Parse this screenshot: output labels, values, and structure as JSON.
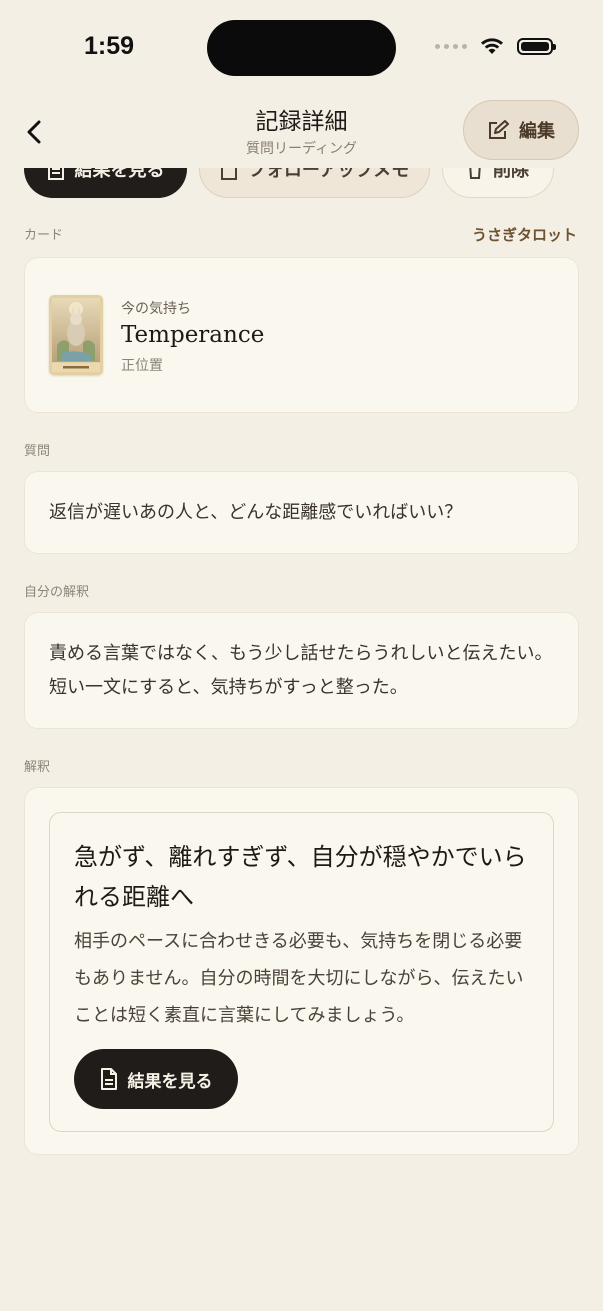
{
  "status_bar": {
    "time": "1:59"
  },
  "nav": {
    "title": "記録詳細",
    "subtitle": "質問リーディング",
    "edit_label": "編集"
  },
  "actions": {
    "view_result_label": "結果を見る",
    "follow_up_label": "フォローアップメモ",
    "delete_label": "削除"
  },
  "card_section": {
    "label": "カード",
    "deck_name": "うさぎタロット",
    "position": "今の気持ち",
    "card_name": "Temperance",
    "orientation": "正位置"
  },
  "question_section": {
    "label": "質問",
    "text": "返信が遅いあの人と、どんな距離感でいればいい？"
  },
  "own_interpretation_section": {
    "label": "自分の解釈",
    "text": "責める言葉ではなく、もう少し話せたらうれしいと伝えたい。短い一文にすると、気持ちがすっと整った。"
  },
  "interpretation_section": {
    "label": "解釈",
    "title": "急がず、離れすぎず、自分が穏やかでいられる距離へ",
    "text": "相手のペースに合わせきる必要も、気持ちを閉じる必要もありません。自分の時間を大切にしながら、伝えたいことは短く素直に言葉にしてみましょう。",
    "button_label": "結果を見る"
  },
  "colors": {
    "background": "#f4efe4",
    "card_bg": "#faf7ee",
    "dark_button": "#1f1c19",
    "accent_brown": "#6e5230"
  }
}
